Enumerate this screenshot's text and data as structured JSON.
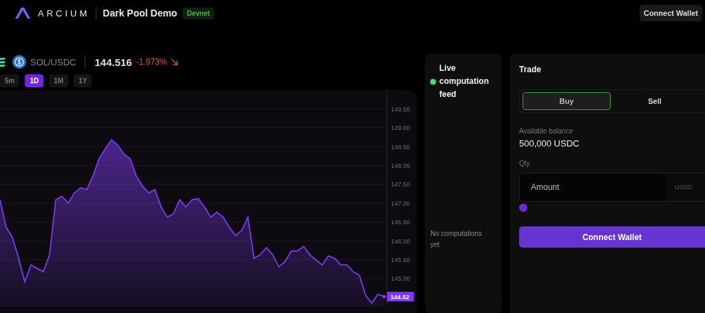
{
  "header": {
    "brand": "ARCIUM",
    "title": "Dark Pool Demo",
    "badge": "Devnet",
    "connect_button": "Connect Wallet"
  },
  "market": {
    "pair": "SOL/USDC",
    "price": "144.516",
    "change": {
      "text": "-1.973%",
      "kind": "down"
    },
    "timeframes": [
      {
        "label": "5m",
        "selected": false
      },
      {
        "label": "1D",
        "selected": true
      },
      {
        "label": "1M",
        "selected": false
      },
      {
        "label": "1Y",
        "selected": false
      }
    ],
    "price_tag": "144.52",
    "chart_data": {
      "type": "area",
      "grid": true,
      "ylim": [
        144.25,
        150
      ],
      "yticks": [
        {
          "value": 145,
          "label": "145.00"
        },
        {
          "value": 145.5,
          "label": "145.50"
        },
        {
          "value": 146,
          "label": "146.00"
        },
        {
          "value": 146.5,
          "label": "146.50"
        },
        {
          "value": 147,
          "label": "147.00"
        },
        {
          "value": 147.5,
          "label": "147.50"
        },
        {
          "value": 148,
          "label": "148.00"
        },
        {
          "value": 148.5,
          "label": "148.50"
        },
        {
          "value": 149,
          "label": "149.00"
        },
        {
          "value": 149.5,
          "label": "149.50"
        }
      ],
      "series": [
        {
          "color": "#7c3aed",
          "values": [
            147.09,
            146.36,
            146.09,
            145.54,
            144.91,
            145.36,
            145.27,
            145.18,
            145.63,
            147.09,
            147.18,
            147.0,
            147.27,
            147.41,
            147.36,
            147.72,
            148.18,
            148.45,
            148.68,
            148.54,
            148.3,
            148.18,
            147.72,
            147.45,
            147.27,
            147.36,
            146.9,
            146.63,
            146.72,
            147.09,
            146.9,
            147.09,
            147.12,
            146.9,
            146.63,
            146.76,
            146.63,
            146.36,
            146.14,
            146.27,
            146.63,
            145.54,
            145.63,
            145.82,
            145.63,
            145.31,
            145.45,
            145.73,
            145.73,
            145.85,
            145.63,
            145.49,
            145.36,
            145.6,
            145.54,
            145.36,
            145.36,
            145.18,
            145.09,
            144.55,
            144.35,
            144.58,
            144.52
          ]
        }
      ]
    }
  },
  "feed": {
    "title": "Live computation feed",
    "live": true,
    "empty_text": "No computations yet"
  },
  "trade": {
    "title": "Trade",
    "sides": [
      {
        "label": "Buy",
        "selected": true
      },
      {
        "label": "Sell",
        "selected": false
      }
    ],
    "balance_label": "Available balance",
    "balance": "500,000 USDC",
    "qty_label": "Qty",
    "amount_placeholder": "Amount",
    "amount_unit": "USDC",
    "slider": {
      "level": 0
    },
    "submit": "Connect Wallet"
  }
}
